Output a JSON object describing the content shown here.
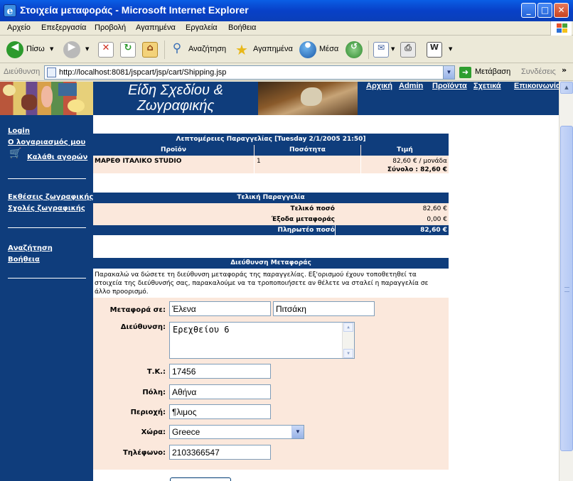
{
  "window": {
    "title": "Στοιχεία μεταφοράς - Microsoft Internet Explorer",
    "min_label": "_",
    "max_label": "□",
    "close_label": "✕"
  },
  "menu": [
    "Αρχείο",
    "Επεξεργασία",
    "Προβολή",
    "Αγαπημένα",
    "Εργαλεία",
    "Βοήθεια"
  ],
  "toolbar": {
    "back_label": "Πίσω",
    "search_label": "Αναζήτηση",
    "favorites_label": "Αγαπημένα",
    "media_label": "Μέσα"
  },
  "address": {
    "label": "Διεύθυνση",
    "url": "http://localhost:8081/jspcart/jsp/cart/Shipping.jsp",
    "go_label": "Μετάβαση",
    "links_label": "Συνδέσεις"
  },
  "site": {
    "title_line1": "Είδη Σχεδίου &",
    "title_line2": "Ζωγραφικής",
    "nav": [
      "Αρχική",
      "Admin",
      "Προϊόντα",
      "Σχετικά",
      "Επικοινωνία"
    ]
  },
  "sidebar": {
    "login": "Login",
    "my_account": "Ο λογαριασμός μου",
    "cart": "Καλάθι αγορών",
    "exhibitions": "Εκθέσεις ζωγραφικής",
    "schools": "Σχολές ζωγραφικής",
    "search": "Αναζήτηση",
    "help": "Βοήθεια"
  },
  "order": {
    "header": "Λεπτομέρειες Παραγγελίας [Tuesday 2/1/2005 21:50]",
    "columns": [
      "Προϊόν",
      "Ποσότητα",
      "Τιμή"
    ],
    "rows": [
      {
        "product": "ΜΑΡΕΘ ΙΤΑΛΙΚΟ STUDIO",
        "quantity": "1",
        "price": "82,60 € / μονάδα",
        "total": "Σύνολο : 82,60 €"
      }
    ]
  },
  "final": {
    "header": "Τελική Παραγγελία",
    "total_label": "Τελικό ποσό",
    "total_value": "82,60 €",
    "shipping_label": "Έξοδα μεταφοράς",
    "shipping_value": "0,00 €",
    "payable_label": "Πληρωτέο ποσό",
    "payable_value": "82,60 €"
  },
  "shipping": {
    "header": "Διεύθυνση Μεταφοράς",
    "intro": [
      "Παρακαλώ να δώσετε τη διεύθυνση μεταφοράς της παραγγελίας. Εξ'ορισμού έχουν τοποθετηθεί τα",
      "στοιχεία της διεύθυνσής σας, παρακαλούμε να τα τροποποιήσετε αν θέλετε να σταλεί η παραγγελία σε",
      "άλλο προορισμό."
    ],
    "fields": {
      "recipient_label": "Μεταφορά σε:",
      "first_name": "Έλενα",
      "last_name": "Πιτσάκη",
      "address_label": "Διεύθυνση:",
      "address": "Ερεχθείου 6",
      "zip_label": "Τ.Κ.:",
      "zip": "17456",
      "city_label": "Πόλη:",
      "city": "Αθήνα",
      "area_label": "Περιοχή:",
      "area": "¶λιμος",
      "country_label": "Χώρα:",
      "country": "Greece",
      "phone_label": "Τηλέφωνο:",
      "phone": "2103366547"
    }
  }
}
